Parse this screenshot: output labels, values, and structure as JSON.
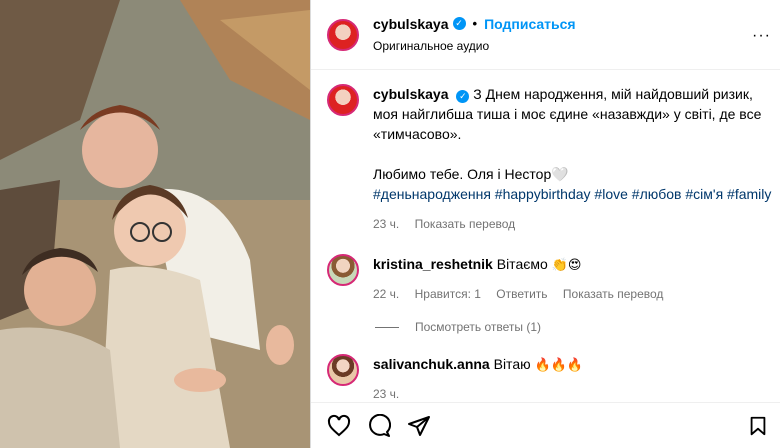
{
  "header": {
    "username": "cybulskaya",
    "follow_label": "Подписаться",
    "audio": "Оригинальное аудио",
    "more_label": "···"
  },
  "caption": {
    "username": "cybulskaya",
    "text": "З Днем народження, мій найдовший ризик, моя найглибша тиша і моє єдине «назавжди» у світі, де все «тимчасово».",
    "text2": "Любимо тебе. Оля і Нестор🤍",
    "hashtags": "#деньнародження #happybirthday #love #любов #сім'я #family",
    "time": "23 ч.",
    "translate": "Показать перевод"
  },
  "comments": [
    {
      "username": "kristina_reshetnik",
      "text": "Вітаємо",
      "emoji": "👏😍",
      "time": "22 ч.",
      "likes": "Нравится: 1",
      "reply": "Ответить",
      "translate": "Показать перевод"
    },
    {
      "username": "salivanchuk.anna",
      "text": "Вітаю",
      "emoji": "🔥🔥🔥",
      "time": "23 ч.",
      "likes": "",
      "reply": "",
      "translate": ""
    }
  ],
  "view_replies": "Посмотреть ответы (1)",
  "actions": {
    "icons": [
      "heart-icon",
      "comment-icon",
      "share-icon",
      "bookmark-icon"
    ]
  },
  "colors": {
    "accent": "#0095f6",
    "hashtag": "#00376b",
    "muted": "#737373"
  }
}
